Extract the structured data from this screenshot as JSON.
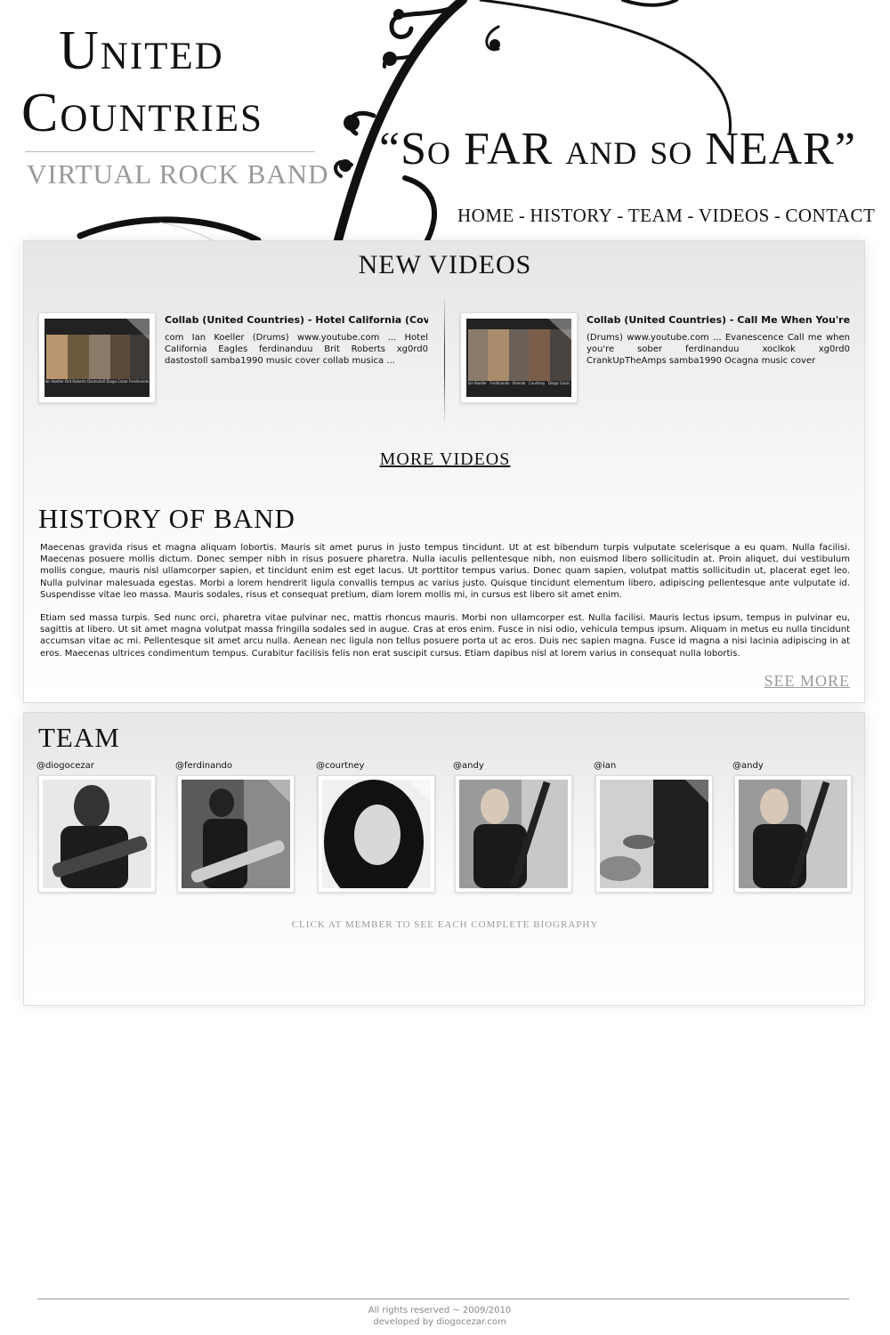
{
  "header": {
    "logo_line1": "United",
    "logo_line2": "Countries",
    "logo_sub": "VIRTUAL ROCK BAND",
    "slogan": "“So  FAR and so  NEAR”"
  },
  "nav": {
    "items": [
      "HOME",
      "HISTORY",
      "TEAM",
      "VIDEOS",
      "CONTACT"
    ],
    "separator": "-"
  },
  "videos": {
    "title": "NEW VIDEOS",
    "items": [
      {
        "title": "Collab (United Countries) - Hotel California (Cover)",
        "description": "com Ian Koeller (Drums) www.youtube.com ... Hotel California Eagles ferdinanduu Brit Roberts xg0rd0 dastostoll samba1990 music cover collab musica ...",
        "thumb_labels": [
          "Ian Koeller",
          "Brit Roberts",
          "Dastostoll",
          "Diogo Cezar",
          "Ferdinando"
        ]
      },
      {
        "title": "Collab (United Countries) - Call Me When You're...",
        "description": "(Drums) www.youtube.com ... Evanescence Call me when you're sober ferdinanduu xoclkok xg0rd0 CrankUpTheAmps samba1990 Ocagna music cover",
        "thumb_labels": [
          "Ian Koeller",
          "Ferdinando",
          "Brenda",
          "Courtney",
          "Diogo Cezar"
        ]
      }
    ],
    "more_label": "MORE VIDEOS"
  },
  "history": {
    "title": "HISTORY OF BAND",
    "paragraphs": [
      "Maecenas gravida risus et magna aliquam lobortis. Mauris sit amet purus in justo tempus tincidunt. Ut at est bibendum turpis vulputate scelerisque a eu quam. Nulla facilisi. Maecenas posuere mollis dictum. Donec semper nibh in risus posuere pharetra. Nulla iaculis pellentesque nibh, non euismod libero sollicitudin at. Proin aliquet, dui vestibulum mollis congue, mauris nisl ullamcorper sapien, et tincidunt enim est eget lacus. Ut porttitor tempus varius. Donec quam sapien, volutpat mattis sollicitudin ut, placerat eget leo. Nulla pulvinar malesuada egestas. Morbi a lorem hendrerit ligula convallis tempus ac varius justo. Quisque tincidunt elementum libero, adipiscing pellentesque ante vulputate id. Suspendisse vitae leo massa. Mauris sodales, risus et consequat pretium, diam lorem mollis mi, in cursus est libero sit amet enim.",
      "Etiam sed massa turpis. Sed nunc orci, pharetra vitae pulvinar nec, mattis rhoncus mauris. Morbi non ullamcorper est. Nulla facilisi. Mauris lectus ipsum, tempus in pulvinar eu, sagittis at libero. Ut sit amet magna volutpat massa fringilla sodales sed in augue. Cras at eros enim. Fusce in nisi odio, vehicula tempus ipsum. Aliquam in metus eu nulla tincidunt accumsan vitae ac mi. Pellentesque sit amet arcu nulla. Aenean nec ligula non tellus posuere porta ut ac eros. Duis nec sapien magna. Fusce id magna a nisi lacinia adipiscing in at eros. Maecenas ultrices condimentum tempus. Curabitur facilisis felis non erat suscipit cursus. Etiam dapibus nisl at lorem varius in consequat nulla lobortis."
    ],
    "see_more_label": "SEE MORE"
  },
  "team": {
    "title": "TEAM",
    "members": [
      {
        "handle": "@diogocezar"
      },
      {
        "handle": "@ferdinando"
      },
      {
        "handle": "@courtney"
      },
      {
        "handle": "@andy"
      },
      {
        "handle": "@ian"
      },
      {
        "handle": "@andy"
      }
    ],
    "note": "CLICK AT MEMBER TO SEE EACH COMPLETE BIOGRAPHY"
  },
  "footer": {
    "line1": "All rights reserved ~ 2009/2010",
    "line2": "developed by diogocezar.com"
  }
}
